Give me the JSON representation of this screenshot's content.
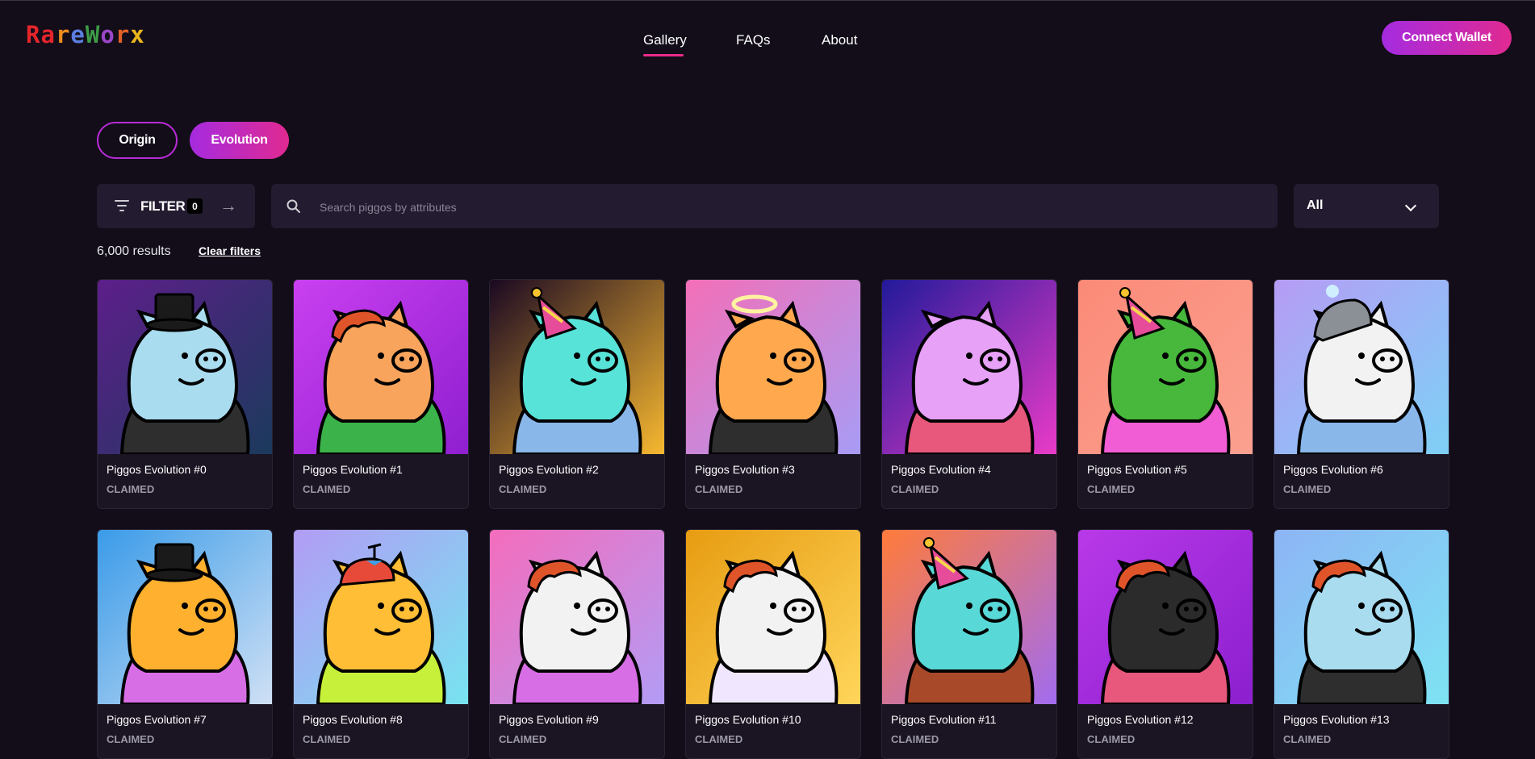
{
  "app": {
    "logo_letters": [
      {
        "ch": "R",
        "color": "#e5252b"
      },
      {
        "ch": "a",
        "color": "#e5252b"
      },
      {
        "ch": "r",
        "color": "#e98d1f"
      },
      {
        "ch": "e",
        "color": "#5b7ee0"
      },
      {
        "ch": "W",
        "color": "#3e9c48"
      },
      {
        "ch": "o",
        "color": "#9b46c9"
      },
      {
        "ch": "r",
        "color": "#e06028"
      },
      {
        "ch": "x",
        "color": "#e9b61c"
      }
    ]
  },
  "nav": {
    "gallery": "Gallery",
    "faqs": "FAQs",
    "about": "About",
    "connect": "Connect Wallet"
  },
  "toggles": {
    "origin": "Origin",
    "evolution": "Evolution"
  },
  "filter": {
    "label": "FILTER",
    "count": "0"
  },
  "search": {
    "placeholder": "Search piggos by attributes",
    "value": ""
  },
  "sort": {
    "value": "All"
  },
  "results": {
    "count": "6,000 results",
    "clear": "Clear filters"
  },
  "cards": [
    {
      "name": "Piggos Evolution #0",
      "status": "CLAIMED",
      "bg1": "#5d1e8a",
      "bg2": "#1b3a5c",
      "body": "#a9dcef",
      "hat": "tophat",
      "outfit": "#2e2e2e"
    },
    {
      "name": "Piggos Evolution #1",
      "status": "CLAIMED",
      "bg1": "#c940f0",
      "bg2": "#8f1fd0",
      "body": "#f9a45c",
      "hat": "hair",
      "outfit": "#3bb24a"
    },
    {
      "name": "Piggos Evolution #2",
      "status": "CLAIMED",
      "bg1": "#1a0822",
      "bg2": "#f7b830",
      "body": "#58e3d8",
      "hat": "party",
      "outfit": "#8ab7ea"
    },
    {
      "name": "Piggos Evolution #3",
      "status": "CLAIMED",
      "bg1": "#f36fb7",
      "bg2": "#a89cf5",
      "body": "#ffa84e",
      "hat": "halo",
      "outfit": "#2e2e2e"
    },
    {
      "name": "Piggos Evolution #4",
      "status": "CLAIMED",
      "bg1": "#221a9a",
      "bg2": "#e93bc8",
      "body": "#e7a1f7",
      "hat": "none",
      "outfit": "#e8577c"
    },
    {
      "name": "Piggos Evolution #5",
      "status": "CLAIMED",
      "bg1": "#fb8a78",
      "bg2": "#fba090",
      "body": "#47b83b",
      "hat": "party",
      "outfit": "#f05dd4"
    },
    {
      "name": "Piggos Evolution #6",
      "status": "CLAIMED",
      "bg1": "#b69cf5",
      "bg2": "#7ed0f6",
      "body": "#f2f2f2",
      "hat": "helmet",
      "outfit": "#8ab7ea"
    },
    {
      "name": "Piggos Evolution #7",
      "status": "CLAIMED",
      "bg1": "#3a9be8",
      "bg2": "#cfe0f5",
      "body": "#ffb02e",
      "hat": "tophat",
      "outfit": "#d86ee6"
    },
    {
      "name": "Piggos Evolution #8",
      "status": "CLAIMED",
      "bg1": "#b29cf5",
      "bg2": "#77e3f0",
      "body": "#ffbe35",
      "hat": "propeller",
      "outfit": "#c7f03a"
    },
    {
      "name": "Piggos Evolution #9",
      "status": "CLAIMED",
      "bg1": "#f46cbc",
      "bg2": "#b39cf5",
      "body": "#f2f2f2",
      "hat": "hair",
      "outfit": "#d86ee6"
    },
    {
      "name": "Piggos Evolution #10",
      "status": "CLAIMED",
      "bg1": "#e79c12",
      "bg2": "#ffd55a",
      "body": "#f2f2f2",
      "hat": "hair",
      "outfit": "#f0e7ff"
    },
    {
      "name": "Piggos Evolution #11",
      "status": "CLAIMED",
      "bg1": "#ff7b3a",
      "bg2": "#a26cf0",
      "body": "#58d8d6",
      "hat": "party",
      "outfit": "#a84a2a"
    },
    {
      "name": "Piggos Evolution #12",
      "status": "CLAIMED",
      "bg1": "#b839e8",
      "bg2": "#8c1fcf",
      "body": "#2b2b2b",
      "hat": "hair",
      "outfit": "#e8577c"
    },
    {
      "name": "Piggos Evolution #13",
      "status": "CLAIMED",
      "bg1": "#8db4f5",
      "bg2": "#7ee3f3",
      "body": "#a9dcef",
      "hat": "hair",
      "outfit": "#2e2e2e"
    }
  ]
}
